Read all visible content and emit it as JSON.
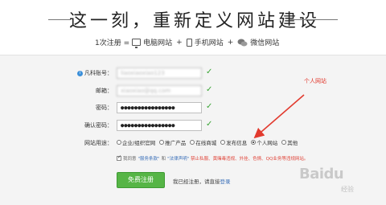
{
  "header": {
    "slogan": "这一刻，重新定义网站建设",
    "steps": {
      "prefix": "1次注册 = ",
      "pc": "电脑网站",
      "mobile": "手机网站",
      "wechat": "微信网站",
      "plus": "+"
    }
  },
  "form": {
    "username": {
      "label": "凡科账号：",
      "value": "liaoxiaoxiao123"
    },
    "email": {
      "label": "邮箱：",
      "value": "xiaoxiao@qq.com"
    },
    "password": {
      "label": "密码：",
      "value": "●●●●●●●●●●●●●●●●"
    },
    "confirm": {
      "label": "确认密码：",
      "value": "●●●●●●●●●●●●●●●●"
    },
    "check_mark": "✓",
    "usage": {
      "label": "网站用途：",
      "options": [
        "企业/组织官网",
        "推广产品",
        "在线商城",
        "发布信息",
        "个人网站",
        "其他"
      ],
      "selected_index": 4
    },
    "agreement": {
      "prefix": "我同意",
      "service_terms": "\"服务条款\"",
      "and": "和",
      "legal": "\"法律声明\"",
      "warning": "禁止私服、黄赌毒违规、外挂、色情、QQ业务等违规网站。"
    },
    "submit_label": "免费注册",
    "login_hint": "我已经注册，请直接",
    "login_link": "登录"
  },
  "annotation": {
    "text": "个人网站",
    "color": "#e23a2e"
  },
  "watermark": {
    "logo": "Baidu",
    "sub": "经验"
  },
  "colors": {
    "accent_green": "#56b546",
    "link_blue": "#3a6fb8",
    "check_green": "#3aa535",
    "warning_red": "#e0453a"
  }
}
